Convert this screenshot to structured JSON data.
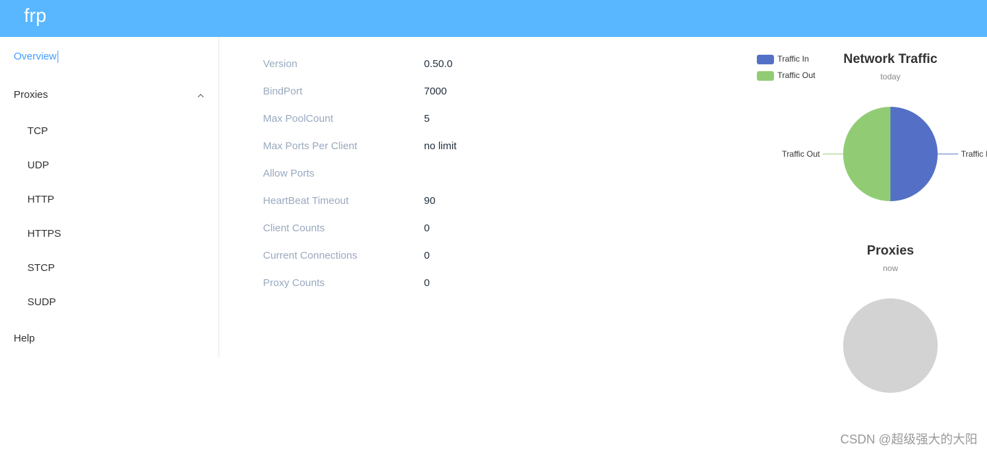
{
  "header": {
    "brand": "frp"
  },
  "sidebar": {
    "overview": "Overview",
    "proxies": "Proxies",
    "proxy_items": [
      "TCP",
      "UDP",
      "HTTP",
      "HTTPS",
      "STCP",
      "SUDP"
    ],
    "help": "Help"
  },
  "server_info": {
    "rows": [
      {
        "label": "Version",
        "value": "0.50.0"
      },
      {
        "label": "BindPort",
        "value": "7000"
      },
      {
        "label": "Max PoolCount",
        "value": "5"
      },
      {
        "label": "Max Ports Per Client",
        "value": "no limit"
      },
      {
        "label": "Allow Ports",
        "value": ""
      },
      {
        "label": "HeartBeat Timeout",
        "value": "90"
      },
      {
        "label": "Client Counts",
        "value": "0"
      },
      {
        "label": "Current Connections",
        "value": "0"
      },
      {
        "label": "Proxy Counts",
        "value": "0"
      }
    ]
  },
  "chart_data": [
    {
      "type": "pie",
      "title": "Network Traffic",
      "subtitle": "today",
      "legend": [
        "Traffic In",
        "Traffic Out"
      ],
      "legend_position": "top-left",
      "categories": [
        "Traffic In",
        "Traffic Out"
      ],
      "values": [
        50,
        50
      ],
      "colors": [
        "#5470c6",
        "#91cc75"
      ]
    },
    {
      "type": "pie",
      "title": "Proxies",
      "subtitle": "now",
      "categories": [],
      "values": [],
      "colors": [
        "#d3d3d3"
      ]
    }
  ],
  "watermark": "CSDN @超级强大的大阳",
  "colors": {
    "header_bg": "#58b7ff",
    "active_link": "#409eff",
    "label_text": "#99a9bf",
    "value_text": "#1f2d3d"
  },
  "icons": {
    "proxies_toggle": "chevron-up-icon"
  }
}
